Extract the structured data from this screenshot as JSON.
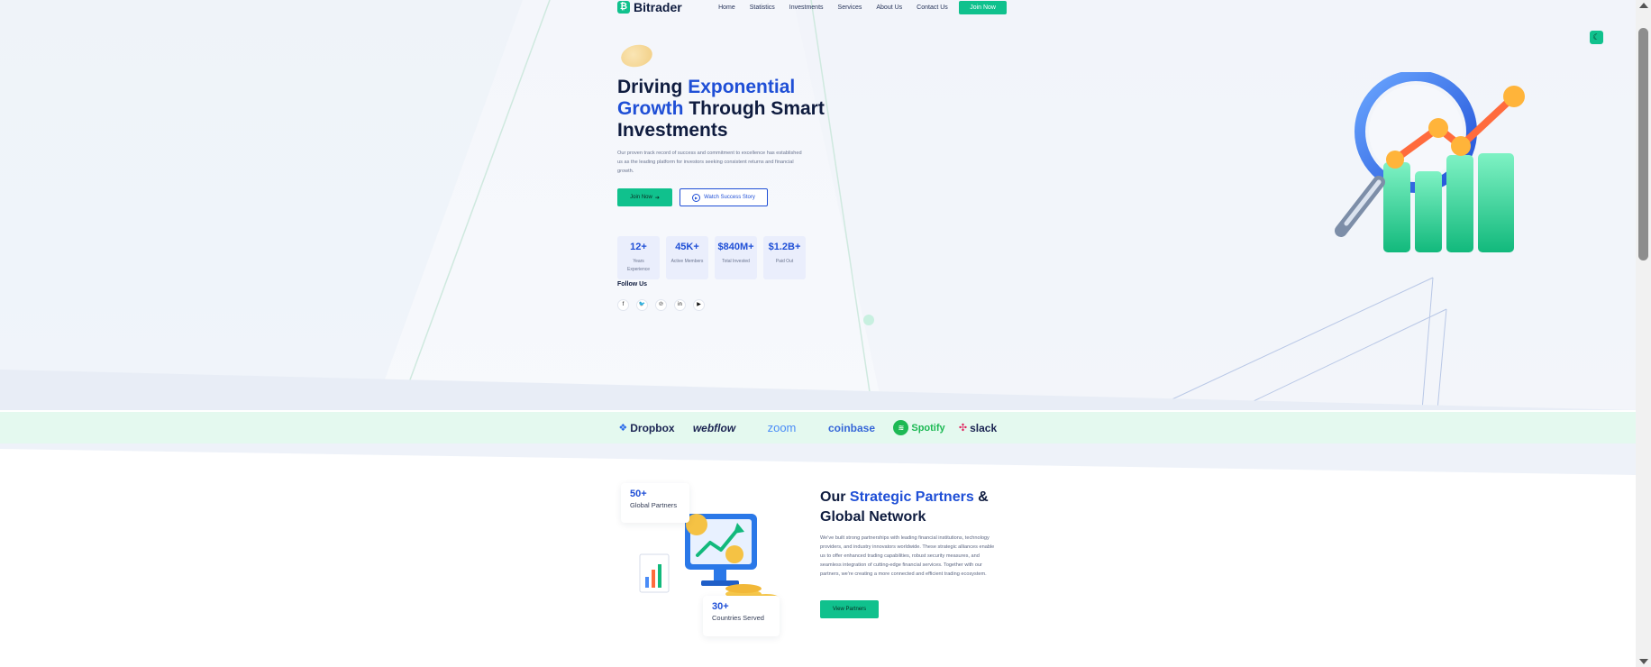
{
  "brand": {
    "name": "Bitrader"
  },
  "nav": {
    "items": [
      "Home",
      "Statistics",
      "Investments",
      "Services",
      "About Us",
      "Contact Us"
    ],
    "cta": "Join Now"
  },
  "hero": {
    "title_pre": "Driving ",
    "title_accent": "Exponential Growth",
    "title_post": " Through Smart Investments",
    "description": "Our proven track record of success and commitment to excellence has established us as the leading platform for investors seeking consistent returns and financial growth.",
    "primary_cta": "Join Now",
    "secondary_cta": "Watch Success Story",
    "stats": [
      {
        "value": "12+",
        "label": "Years Experience"
      },
      {
        "value": "45K+",
        "label": "Active Members"
      },
      {
        "value": "$840M+",
        "label": "Total Invested"
      },
      {
        "value": "$1.2B+",
        "label": "Paid Out"
      }
    ],
    "follow_label": "Follow Us",
    "socials": [
      "facebook-icon",
      "twitter-icon",
      "pinterest-icon",
      "linkedin-icon",
      "youtube-icon"
    ]
  },
  "brands": [
    "Dropbox",
    "webflow",
    "zoom",
    "coinbase",
    "Spotify",
    "slack"
  ],
  "partners": {
    "title_pre": "Our ",
    "title_accent": "Strategic Partners",
    "title_post": " & Global Network",
    "description": "We've built strong partnerships with leading financial institutions, technology providers, and industry innovators worldwide. These strategic alliances enable us to offer enhanced trading capabilities, robust security measures, and seamless integration of cutting-edge financial services. Together with our partners, we're creating a more connected and efficient trading ecosystem.",
    "cta": "View Partners",
    "badges": [
      {
        "value": "50+",
        "label": "Global Partners"
      },
      {
        "value": "30+",
        "label": "Countries Served"
      }
    ]
  },
  "colors": {
    "accent_green": "#10c18d",
    "accent_blue": "#1f4fd6",
    "navy": "#0f1c3f",
    "brand_strip": "#e4f9ef"
  }
}
